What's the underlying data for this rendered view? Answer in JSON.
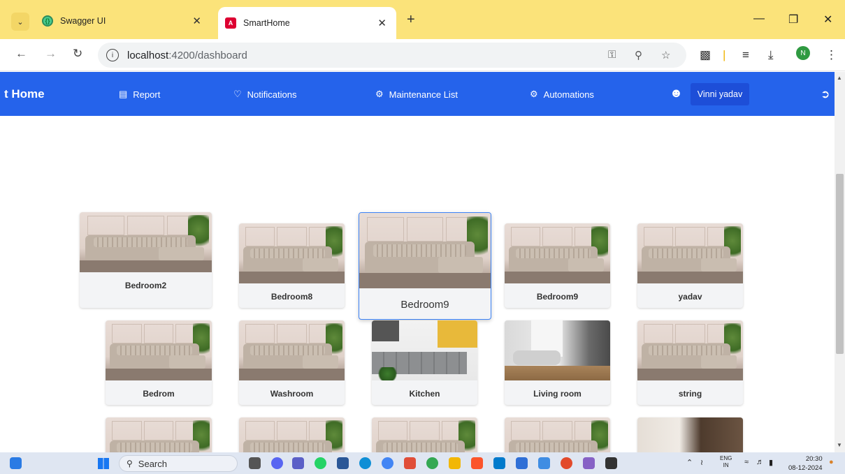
{
  "browser": {
    "tabs": [
      {
        "title": "Swagger UI",
        "favicon": "swagger-icon",
        "active": false
      },
      {
        "title": "SmartHome",
        "favicon": "angular-icon",
        "active": true
      }
    ],
    "url_host": "localhost",
    "url_path": ":4200/dashboard",
    "profile_initial": "N"
  },
  "appbar": {
    "brand": "t Home",
    "links": [
      {
        "label": "Report",
        "icon": "report-icon"
      },
      {
        "label": "Notifications",
        "icon": "bell-icon"
      },
      {
        "label": "Maintenance List",
        "icon": "wrench-icon"
      },
      {
        "label": "Automations",
        "icon": "gears-icon"
      }
    ],
    "user_name": "Vinni yadav",
    "accent": "#2563eb"
  },
  "rooms": [
    {
      "label": "Bedroom2",
      "image": "sofa"
    },
    {
      "label": "Bedroom8",
      "image": "sofa"
    },
    {
      "label": "Bedroom9",
      "image": "sofa"
    },
    {
      "label": "Bedroom9",
      "image": "sofa"
    },
    {
      "label": "yadav",
      "image": "sofa"
    },
    {
      "label": "Bedrom",
      "image": "sofa"
    },
    {
      "label": "Washroom",
      "image": "sofa"
    },
    {
      "label": "Kitchen",
      "image": "kitchen"
    },
    {
      "label": "Living room",
      "image": "living"
    },
    {
      "label": "string",
      "image": "sofa"
    }
  ],
  "taskbar": {
    "search_label": "Search",
    "language": "ENG",
    "region": "IN",
    "time": "20:30",
    "date": "08-12-2024"
  }
}
